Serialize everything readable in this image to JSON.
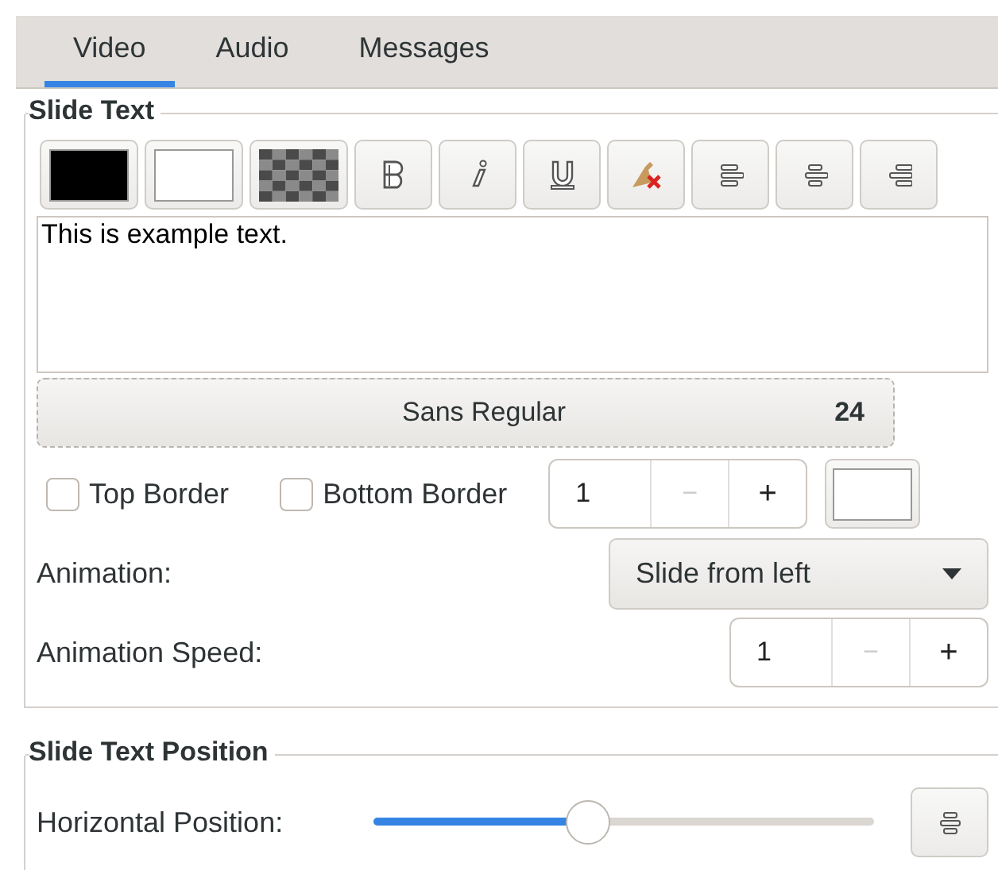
{
  "tabs": [
    {
      "label": "Video",
      "selected": true
    },
    {
      "label": "Audio",
      "selected": false
    },
    {
      "label": "Messages",
      "selected": false
    }
  ],
  "slide_text": {
    "title": "Slide Text",
    "toolbar": [
      {
        "kind": "swatch",
        "color": "#000000"
      },
      {
        "kind": "swatch",
        "color": "#ffffff"
      },
      {
        "kind": "pattern"
      },
      {
        "kind": "bold"
      },
      {
        "kind": "italic"
      },
      {
        "kind": "underline"
      },
      {
        "kind": "clear"
      },
      {
        "kind": "align-left"
      },
      {
        "kind": "align-center"
      },
      {
        "kind": "align-right"
      }
    ],
    "text": "This is example text.",
    "font": {
      "name": "Sans Regular",
      "size": "24"
    },
    "borders": [
      {
        "label": "Top Border",
        "checked": false
      },
      {
        "label": "Bottom Border",
        "checked": false
      }
    ],
    "border_width": {
      "value": "1",
      "minus": "−",
      "plus": "+"
    },
    "border_color_button": {
      "color": "#ffffff"
    },
    "animation": {
      "label": "Animation:",
      "value": "Slide from left"
    },
    "speed": {
      "label": "Animation Speed:",
      "value": "1",
      "minus": "−",
      "plus": "+"
    }
  },
  "position": {
    "title": "Slide Text Position",
    "horizontal": {
      "label": "Horizontal Position:",
      "level": 0.43
    }
  }
}
